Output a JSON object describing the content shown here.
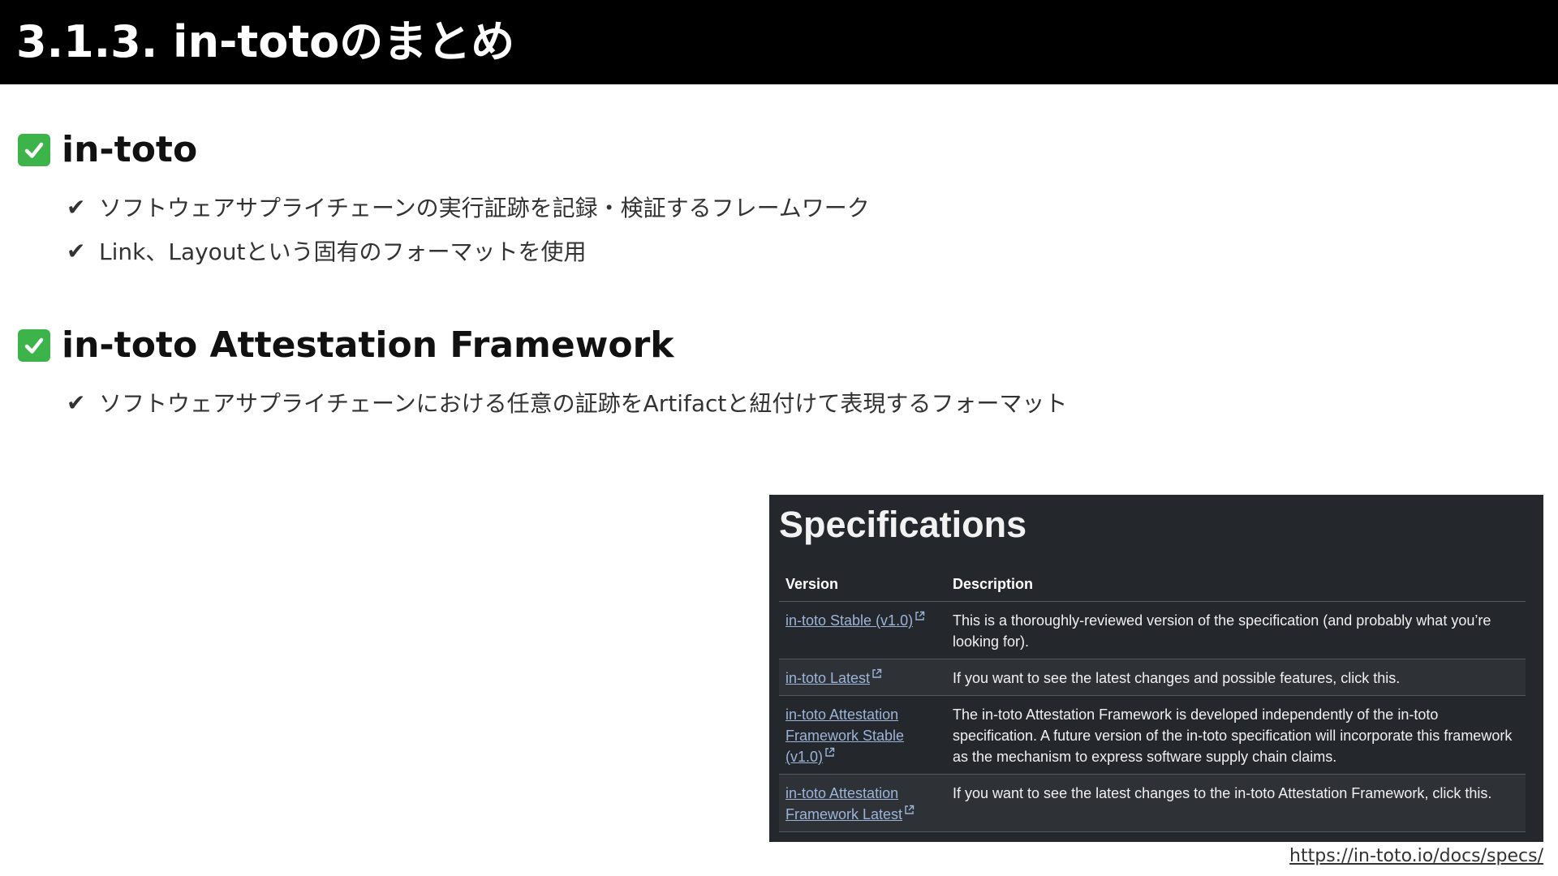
{
  "slide": {
    "title": "3.1.3. in-totoのまとめ"
  },
  "sections": [
    {
      "heading": "in-toto",
      "bullets": [
        "ソフトウェアサプライチェーンの実行証跡を記録・検証するフレームワーク",
        "Link、Layoutという固有のフォーマットを使用"
      ]
    },
    {
      "heading": "in-toto Attestation Framework",
      "bullets": [
        "ソフトウェアサプライチェーンにおける任意の証跡をArtifactと紐付けて表現するフォーマット"
      ]
    }
  ],
  "bullet_glyph": "✔",
  "specs": {
    "title": "Specifications",
    "headers": {
      "version": "Version",
      "description": "Description"
    },
    "rows": [
      {
        "version": "in-toto Stable (v1.0)",
        "description": "This is a thoroughly-reviewed version of the specification (and probably what you’re looking for)."
      },
      {
        "version": "in-toto Latest",
        "description": "If you want to see the latest changes and possible features, click this."
      },
      {
        "version": "in-toto Attestation Framework Stable (v1.0)",
        "description": "The in-toto Attestation Framework is developed independently of the in-toto specification. A future version of the in-toto specification will incorporate this framework as the mechanism to express software supply chain claims."
      },
      {
        "version": "in-toto Attestation Framework Latest",
        "description": "If you want to see the latest changes to the in-toto Attestation Framework, click this."
      }
    ]
  },
  "source_url": "https://in-toto.io/docs/specs/",
  "icons": {
    "section_marker": "check-mark-button-icon",
    "bullet": "heavy-check-mark-icon",
    "link": "external-link-icon"
  },
  "colors": {
    "title_bar": "#000000",
    "check_green": "#3cb44a",
    "panel_bg": "#24272b",
    "link": "#9bb4d8"
  }
}
